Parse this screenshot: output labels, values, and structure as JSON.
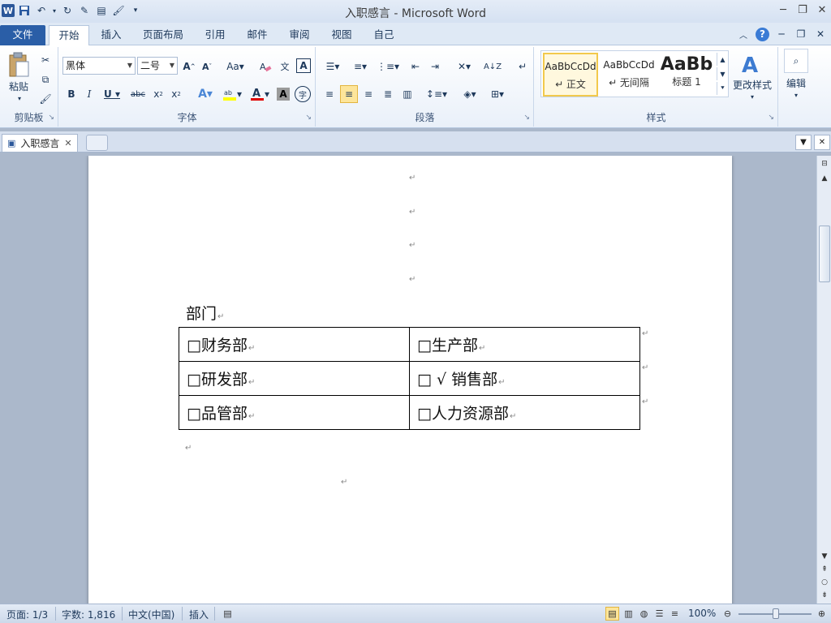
{
  "window": {
    "title": "入职感言  -  Microsoft Word",
    "app_icon": "W"
  },
  "ribbon_tabs": [
    {
      "label": "文件"
    },
    {
      "label": "开始"
    },
    {
      "label": "插入"
    },
    {
      "label": "页面布局"
    },
    {
      "label": "引用"
    },
    {
      "label": "邮件"
    },
    {
      "label": "审阅"
    },
    {
      "label": "视图"
    },
    {
      "label": "自己"
    }
  ],
  "clipboard": {
    "paste_label": "粘贴",
    "group_label": "剪贴板"
  },
  "font": {
    "name": "黑体",
    "size": "二号",
    "group_label": "字体"
  },
  "paragraph": {
    "group_label": "段落"
  },
  "styles": {
    "items": [
      {
        "sample": "AaBbCcDd",
        "name": "↵ 正文"
      },
      {
        "sample": "AaBbCcDd",
        "name": "↵ 无间隔"
      },
      {
        "sample": "AaBb",
        "name": "标题 1"
      }
    ],
    "change_label": "更改样式",
    "group_label": "样式"
  },
  "editing": {
    "label": "编辑"
  },
  "document_tab": {
    "label": "入职感言"
  },
  "document": {
    "heading": "部门",
    "table": [
      [
        "□财务部",
        "□生产部"
      ],
      [
        "□研发部",
        "□ √ 销售部"
      ],
      [
        "□品管部",
        "□人力资源部"
      ]
    ],
    "para_mark": "↵"
  },
  "status": {
    "page": "页面: 1/3",
    "words": "字数: 1,816",
    "language": "中文(中国)",
    "mode": "插入",
    "zoom": "100%"
  },
  "colors": {
    "file_tab": "#2a5ea7",
    "font_color_red": "#e00000",
    "highlight_yellow": "#ffff00"
  }
}
